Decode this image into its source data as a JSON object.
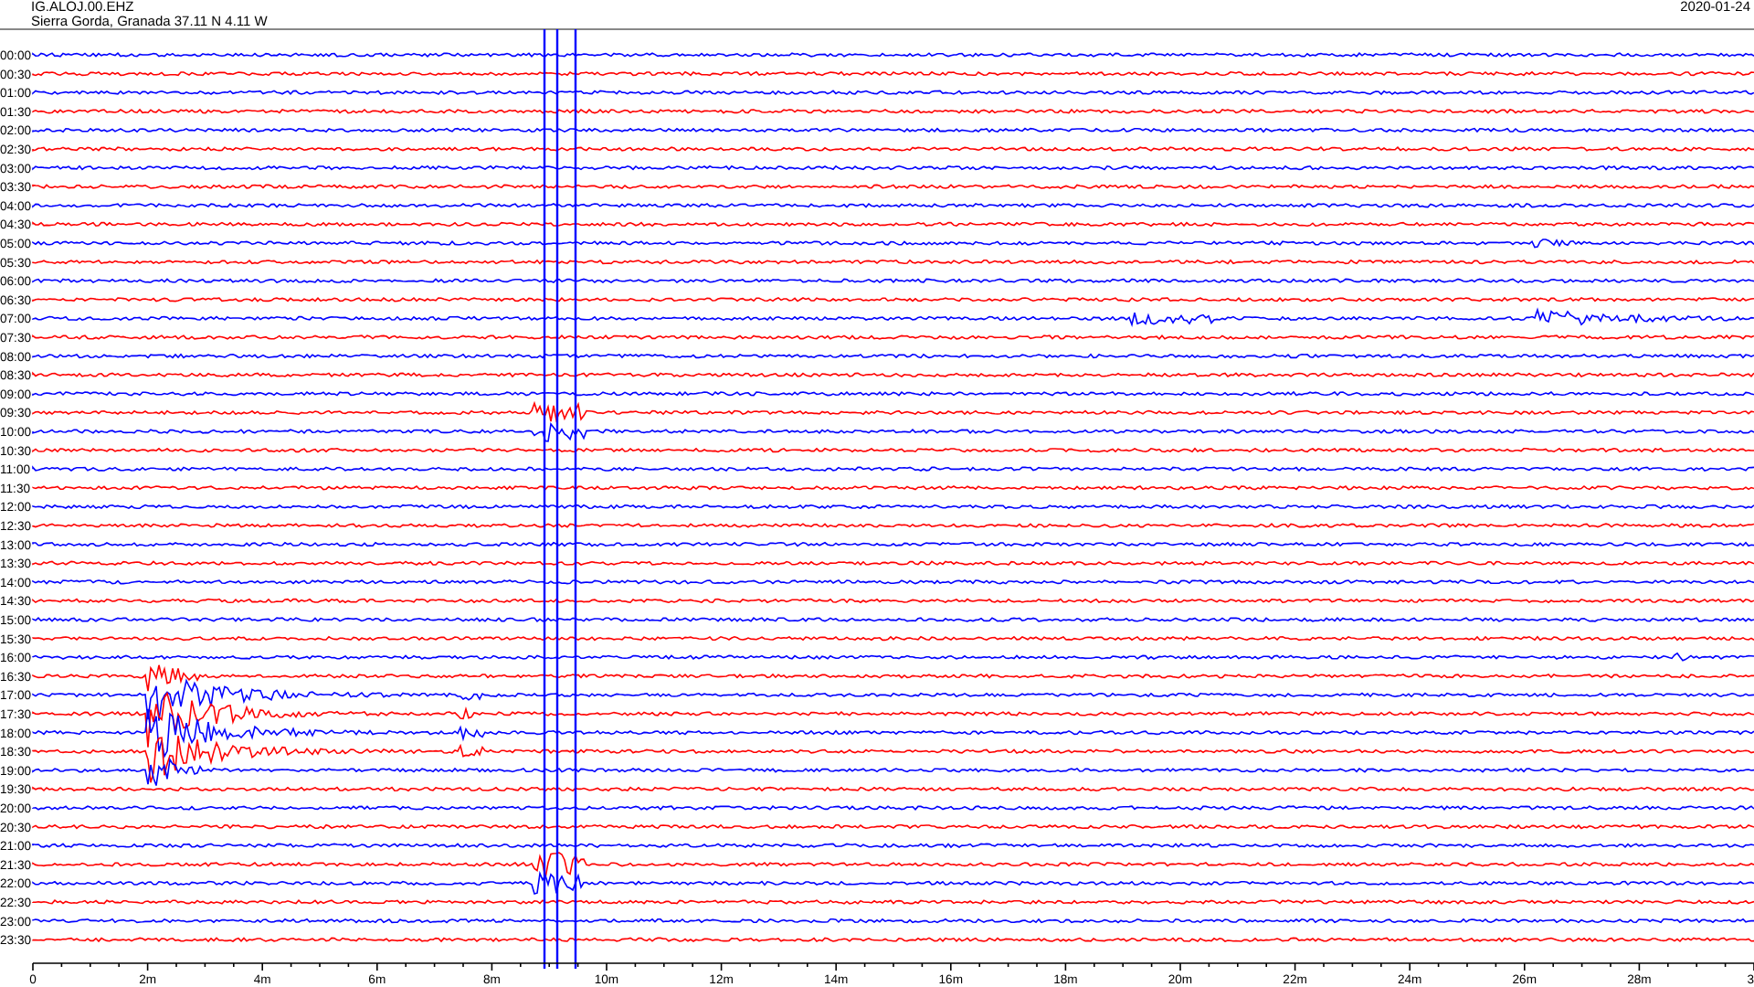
{
  "header": {
    "station": "IG.ALOJ.00.EHZ",
    "location": "Sierra Gorda, Granada  37.11 N 4.11 W",
    "date": "2020-01-24"
  },
  "rows": [
    {
      "time": "00:00",
      "color": "#0000ff"
    },
    {
      "time": "00:30",
      "color": "#ff0000"
    },
    {
      "time": "01:00",
      "color": "#0000ff"
    },
    {
      "time": "01:30",
      "color": "#ff0000"
    },
    {
      "time": "02:00",
      "color": "#0000ff"
    },
    {
      "time": "02:30",
      "color": "#ff0000"
    },
    {
      "time": "03:00",
      "color": "#0000ff"
    },
    {
      "time": "03:30",
      "color": "#ff0000"
    },
    {
      "time": "04:00",
      "color": "#0000ff"
    },
    {
      "time": "04:30",
      "color": "#ff0000"
    },
    {
      "time": "05:00",
      "color": "#0000ff"
    },
    {
      "time": "05:30",
      "color": "#ff0000"
    },
    {
      "time": "06:00",
      "color": "#0000ff"
    },
    {
      "time": "06:30",
      "color": "#ff0000"
    },
    {
      "time": "07:00",
      "color": "#0000ff"
    },
    {
      "time": "07:30",
      "color": "#ff0000"
    },
    {
      "time": "08:00",
      "color": "#0000ff"
    },
    {
      "time": "08:30",
      "color": "#ff0000"
    },
    {
      "time": "09:00",
      "color": "#0000ff"
    },
    {
      "time": "09:30",
      "color": "#ff0000"
    },
    {
      "time": "10:00",
      "color": "#0000ff"
    },
    {
      "time": "10:30",
      "color": "#ff0000"
    },
    {
      "time": "11:00",
      "color": "#0000ff"
    },
    {
      "time": "11:30",
      "color": "#ff0000"
    },
    {
      "time": "12:00",
      "color": "#0000ff"
    },
    {
      "time": "12:30",
      "color": "#ff0000"
    },
    {
      "time": "13:00",
      "color": "#0000ff"
    },
    {
      "time": "13:30",
      "color": "#ff0000"
    },
    {
      "time": "14:00",
      "color": "#0000ff"
    },
    {
      "time": "14:30",
      "color": "#ff0000"
    },
    {
      "time": "15:00",
      "color": "#0000ff"
    },
    {
      "time": "15:30",
      "color": "#ff0000"
    },
    {
      "time": "16:00",
      "color": "#0000ff"
    },
    {
      "time": "16:30",
      "color": "#ff0000"
    },
    {
      "time": "17:00",
      "color": "#0000ff"
    },
    {
      "time": "17:30",
      "color": "#ff0000"
    },
    {
      "time": "18:00",
      "color": "#0000ff"
    },
    {
      "time": "18:30",
      "color": "#ff0000"
    },
    {
      "time": "19:00",
      "color": "#0000ff"
    },
    {
      "time": "19:30",
      "color": "#ff0000"
    },
    {
      "time": "20:00",
      "color": "#0000ff"
    },
    {
      "time": "20:30",
      "color": "#ff0000"
    },
    {
      "time": "21:00",
      "color": "#0000ff"
    },
    {
      "time": "21:30",
      "color": "#ff0000"
    },
    {
      "time": "22:00",
      "color": "#0000ff"
    },
    {
      "time": "22:30",
      "color": "#ff0000"
    },
    {
      "time": "23:00",
      "color": "#0000ff"
    },
    {
      "time": "23:30",
      "color": "#ff0000"
    }
  ],
  "x_axis": {
    "labels": [
      "0",
      "2m",
      "4m",
      "6m",
      "8m",
      "10m",
      "12m",
      "14m",
      "16m",
      "18m",
      "20m",
      "22m",
      "24m",
      "26m",
      "28m",
      "3"
    ]
  }
}
